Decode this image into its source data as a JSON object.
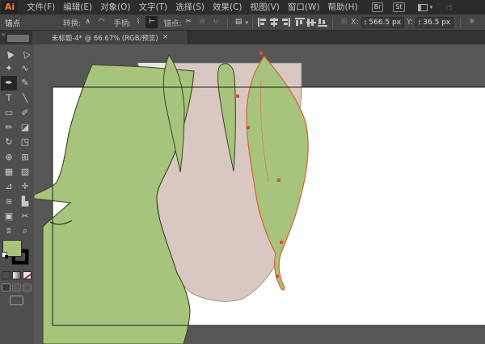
{
  "menu_bar": {
    "logo": "Ai",
    "items": [
      {
        "label": "文件(F)"
      },
      {
        "label": "编辑(E)"
      },
      {
        "label": "对象(O)"
      },
      {
        "label": "文字(T)"
      },
      {
        "label": "选择(S)"
      },
      {
        "label": "效果(C)"
      },
      {
        "label": "视图(V)"
      },
      {
        "label": "窗口(W)"
      },
      {
        "label": "帮助(H)"
      }
    ],
    "bridge_button": "Br",
    "stock_button": "St",
    "workspace_caret": "▾",
    "touch_workspace_glyph": "☝"
  },
  "options_bar": {
    "panel_label": "锚点",
    "convert_label": "转换:",
    "handles_label": "手柄:",
    "anchors_label": "锚点:",
    "x_label": "X:",
    "x_value": "566.5 px",
    "y_label": "Y:",
    "y_value": "36.5 px",
    "icons": {
      "convert_corner": "∧",
      "convert_smooth": "◠",
      "handles_show": "⌇",
      "handles_hide": "⊢",
      "cut_path": "✂",
      "delete_anchor": "⊖",
      "connect_path": "∪",
      "doc_setup": "▤",
      "caret": "▾",
      "reference_point": "⊞",
      "isolate": "✱",
      "stepper_up": "▴",
      "stepper_down": "▾"
    }
  },
  "document_tab": {
    "title": "未标题-4* @ 66.67% (RGB/预览)",
    "close_glyph": "×",
    "chevrons": "»"
  },
  "toolbar": {
    "tools": [
      {
        "name": "selection-tool",
        "glyph": "▲"
      },
      {
        "name": "direct-selection-tool",
        "glyph": "△"
      },
      {
        "name": "magic-wand-tool",
        "glyph": "✦"
      },
      {
        "name": "lasso-tool",
        "glyph": "∿"
      },
      {
        "name": "pen-tool",
        "glyph": "✒",
        "selected": true
      },
      {
        "name": "curvature-tool",
        "glyph": "✎"
      },
      {
        "name": "type-tool",
        "glyph": "T"
      },
      {
        "name": "line-segment-tool",
        "glyph": "╲"
      },
      {
        "name": "rectangle-tool",
        "glyph": "▭"
      },
      {
        "name": "paintbrush-tool",
        "glyph": "✐"
      },
      {
        "name": "pencil-tool",
        "glyph": "✏"
      },
      {
        "name": "eraser-tool",
        "glyph": "◪"
      },
      {
        "name": "rotate-tool",
        "glyph": "↻"
      },
      {
        "name": "scale-tool",
        "glyph": "◳"
      },
      {
        "name": "shape-builder-tool",
        "glyph": "⊕"
      },
      {
        "name": "perspective-grid-tool",
        "glyph": "⊞"
      },
      {
        "name": "mesh-tool",
        "glyph": "▦"
      },
      {
        "name": "gradient-tool",
        "glyph": "▧"
      },
      {
        "name": "eyedropper-tool",
        "glyph": "⊿"
      },
      {
        "name": "blend-tool",
        "glyph": "✛"
      },
      {
        "name": "symbol-sprayer-tool",
        "glyph": "≋"
      },
      {
        "name": "column-graph-tool",
        "glyph": "▙"
      },
      {
        "name": "artboard-tool",
        "glyph": "▣"
      },
      {
        "name": "slice-tool",
        "glyph": "✂"
      },
      {
        "name": "hand-tool",
        "glyph": "ʬ"
      },
      {
        "name": "zoom-tool",
        "glyph": "⌕"
      }
    ],
    "fill_color": "#a7c47d",
    "stroke_color": "#000000"
  },
  "canvas": {
    "pasteboard_color": "#575757",
    "artboard_color": "#ffffff",
    "artboard_border_color": "#1c1c1c",
    "artwork": {
      "green": "#a7c47d",
      "green_outline": "#3a451f",
      "skin": "#d9c8c2",
      "skin_outline": "#93817a",
      "skin_light": "#ece7e2",
      "selection_stroke": "#d46a3a",
      "anchor_color": "#dd4f38"
    }
  }
}
